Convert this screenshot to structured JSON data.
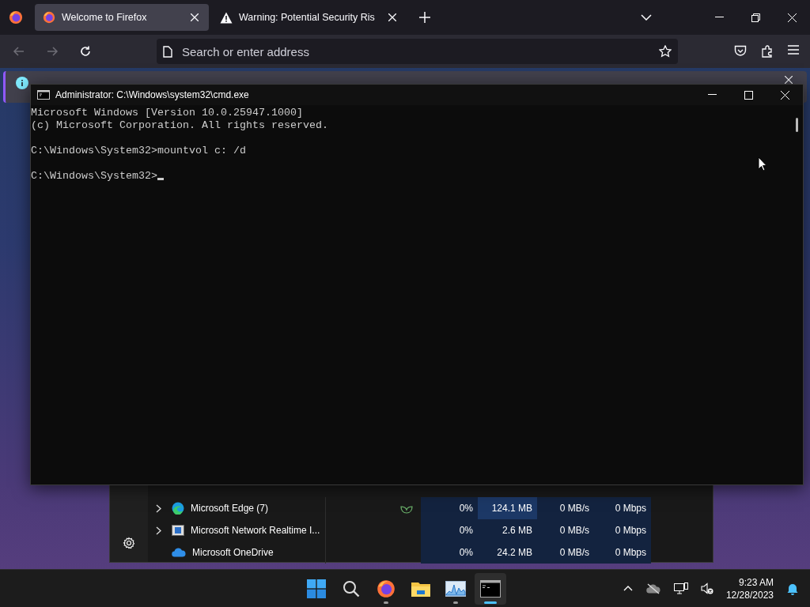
{
  "browser": {
    "tabs": [
      {
        "title": "Welcome to Firefox",
        "kind": "firefox",
        "selected": true
      },
      {
        "title": "Warning: Potential Security Ris",
        "kind": "warning",
        "selected": false
      }
    ],
    "nav_buttons": [
      {
        "kind": "back",
        "disabled": true
      },
      {
        "kind": "forward",
        "disabled": true
      },
      {
        "kind": "reload",
        "disabled": false
      }
    ],
    "address": {
      "placeholder": "Search or enter address"
    }
  },
  "cmd": {
    "title": "Administrator: C:\\Windows\\system32\\cmd.exe",
    "blocks": [
      [
        "Microsoft Windows [Version 10.0.25947.1000]",
        "(c) Microsoft Corporation. All rights reserved."
      ],
      [
        "C:\\Windows\\System32>mountvol c: /d"
      ],
      [
        "C:\\Windows\\System32>"
      ]
    ],
    "cursor": true
  },
  "task_manager": {
    "rows": [
      {
        "name": "Microsoft Edge (7)",
        "kind": "edge",
        "expandable": true,
        "efficiency_mode": true,
        "cpu": "0%",
        "memory": "124.1 MB",
        "memory_highlight": true,
        "disk": "0 MB/s",
        "network": "0 Mbps"
      },
      {
        "name": "Microsoft Network Realtime I...",
        "kind": "app",
        "expandable": true,
        "efficiency_mode": false,
        "cpu": "0%",
        "memory": "2.6 MB",
        "memory_highlight": false,
        "disk": "0 MB/s",
        "network": "0 Mbps"
      },
      {
        "name": "Microsoft OneDrive",
        "kind": "onedrive",
        "expandable": false,
        "efficiency_mode": false,
        "cpu": "0%",
        "memory": "24.2 MB",
        "memory_highlight": false,
        "disk": "0 MB/s",
        "network": "0 Mbps"
      }
    ]
  },
  "taskbar": {
    "apps": [
      {
        "kind": "start",
        "running": false,
        "active": false
      },
      {
        "kind": "search",
        "running": false,
        "active": false
      },
      {
        "kind": "firefox",
        "running": true,
        "active": false
      },
      {
        "kind": "explorer",
        "running": false,
        "active": false
      },
      {
        "kind": "monitor",
        "running": true,
        "active": false
      },
      {
        "kind": "terminal",
        "running": true,
        "active": true
      }
    ],
    "clock": {
      "time": "9:23 AM",
      "date": "12/28/2023"
    }
  }
}
